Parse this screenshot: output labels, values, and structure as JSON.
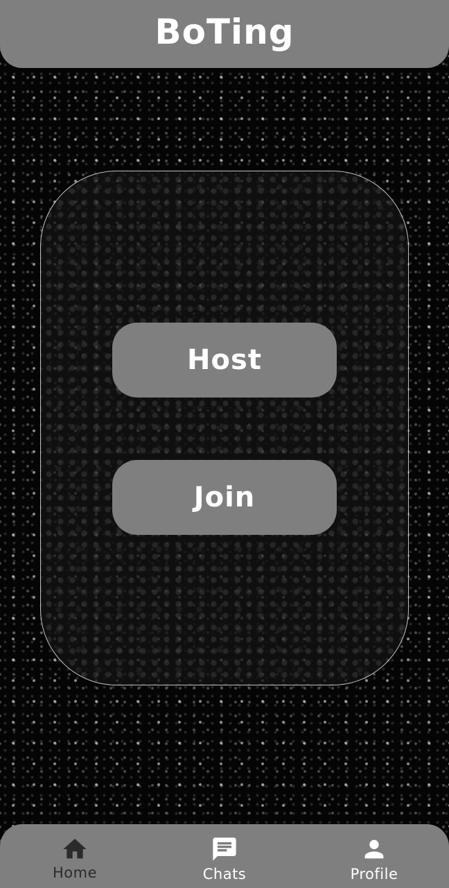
{
  "header": {
    "title": "BoTing"
  },
  "main": {
    "host_label": "Host",
    "join_label": "Join"
  },
  "bottom_nav": {
    "items": [
      {
        "label": "Home",
        "icon": "home-icon",
        "active": true
      },
      {
        "label": "Chats",
        "icon": "chat-icon",
        "active": false
      },
      {
        "label": "Profile",
        "icon": "person-icon",
        "active": false
      }
    ]
  },
  "colors": {
    "bar": "#7f7f7f",
    "background": "#050505",
    "text": "#ffffff",
    "active_nav": "#2b2b2b"
  }
}
